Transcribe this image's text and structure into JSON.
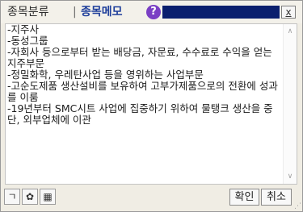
{
  "tabs": {
    "category_label": "종목분류",
    "separator": "|",
    "memo_label": "종목메모"
  },
  "help_icon": "?",
  "close_icon": "x",
  "memo": {
    "text": "-지주사\n-동성그룹\n-자회사 등으로부터 받는 배당금, 자문료, 수수료로 수익을 얻는 지주부문\n-정밀화학, 우레탄사업 등을 영위하는 사업부문\n-고순도제품 생산설비를 보유하여 고부가제품으로의 전환에 성과를 이룸\n-19년부터 SMC시트 사업에 집중하기 위하여 물탱크 생산을 중단, 외부업체에 이관"
  },
  "scrollbar": {
    "up_arrow": "∧",
    "down_arrow": "∨"
  },
  "toolbar": {
    "tool_1": "ㄱ",
    "tool_2": "✿",
    "tool_3": "▦",
    "ok_label": "확인",
    "cancel_label": "취소"
  },
  "resize_grip": "⋰",
  "colors": {
    "memo_tab": "#1e3e9b",
    "help_button": "#7a3fc4",
    "title_fill": "#0a1f6e"
  }
}
